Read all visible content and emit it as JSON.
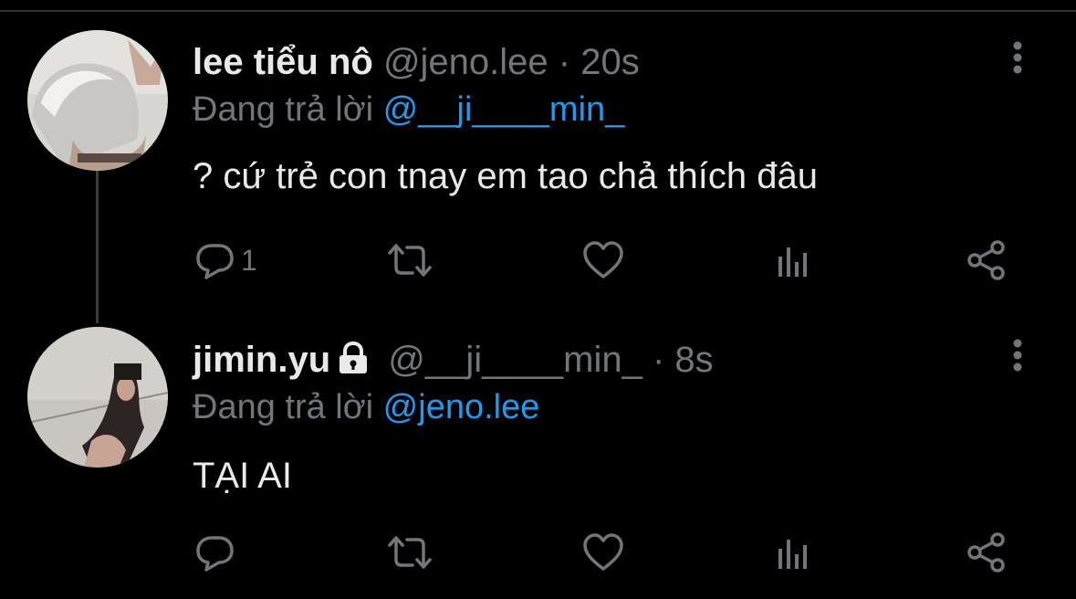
{
  "tweets": [
    {
      "display_name": "lee tiểu nô",
      "handle": "@jeno.lee",
      "separator": "·",
      "time": "20s",
      "reply_prefix": "Đang trả lời",
      "reply_to": "@__ji____min_",
      "text": "? cứ trẻ con tnay em tao chả thích đâu",
      "reply_count": "1",
      "locked": false
    },
    {
      "display_name": "jimin.yu",
      "handle": "@__ji____min_",
      "separator": "·",
      "time": "8s",
      "reply_prefix": "Đang trả lời",
      "reply_to": "@jeno.lee",
      "text": "TẠI AI",
      "reply_count": "",
      "locked": true
    }
  ],
  "icons": [
    "reply-icon",
    "retweet-icon",
    "like-icon",
    "views-icon",
    "share-icon",
    "more-icon",
    "lock-icon"
  ],
  "colors": {
    "background": "#000000",
    "text": "#e7e9ea",
    "muted": "#71767b",
    "link": "#1d9bf0"
  }
}
